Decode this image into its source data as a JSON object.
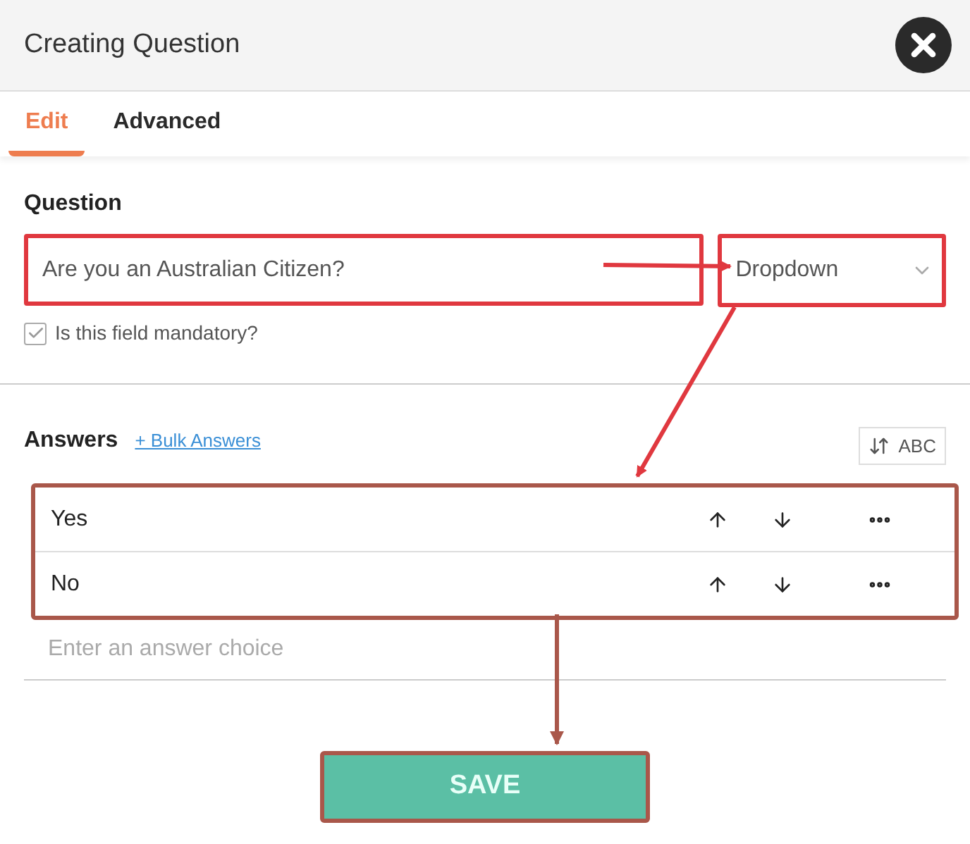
{
  "window": {
    "title": "Creating Question"
  },
  "tabs": [
    {
      "label": "Edit",
      "selected": true
    },
    {
      "label": "Advanced",
      "selected": false
    }
  ],
  "question": {
    "label": "Question",
    "value": "Are you an Australian Citizen?",
    "type": "Dropdown",
    "mandatory": {
      "label": "Is this field mandatory?",
      "checked": true
    }
  },
  "answers": {
    "label": "Answers",
    "bulk_link": "+ Bulk Answers",
    "sort_label": "ABC",
    "items": [
      {
        "text": "Yes"
      },
      {
        "text": "No"
      }
    ],
    "placeholder": "Enter an answer choice"
  },
  "save_button": "SAVE"
}
